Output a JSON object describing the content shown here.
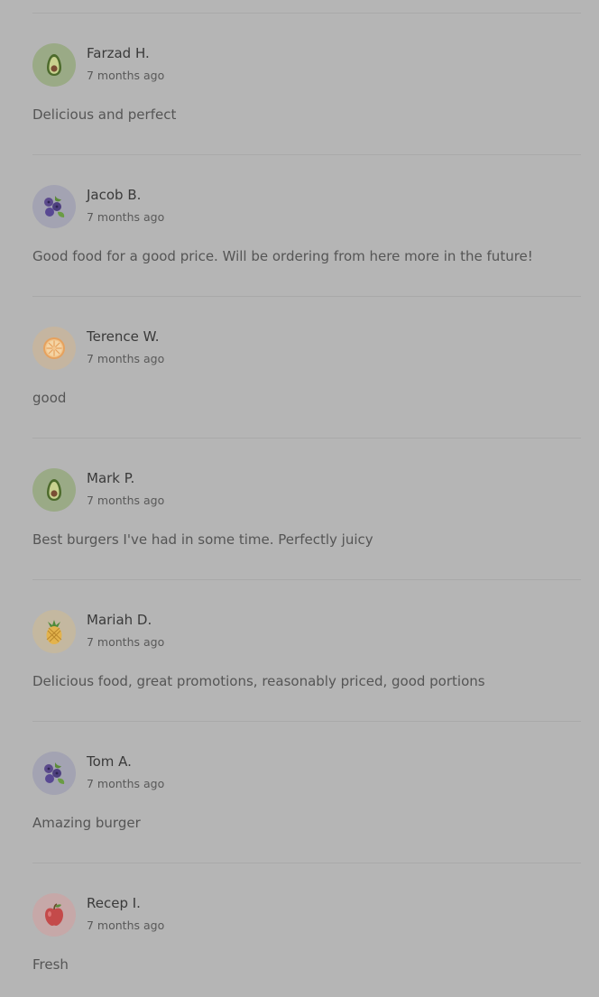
{
  "reviews": [
    {
      "name": "Farzad H.",
      "time": "7 months ago",
      "comment": "Delicious and perfect",
      "avatar_icon": "avocado-icon",
      "avatar_bg": "#9aaa86"
    },
    {
      "name": "Jacob B.",
      "time": "7 months ago",
      "comment": "Good food for a good price. Will be ordering from here more in the future!",
      "avatar_icon": "blueberry-icon",
      "avatar_bg": "#a3a3b2"
    },
    {
      "name": "Terence W.",
      "time": "7 months ago",
      "comment": "good",
      "avatar_icon": "orange-slice-icon",
      "avatar_bg": "#c5b5a0"
    },
    {
      "name": "Mark P.",
      "time": "7 months ago",
      "comment": "Best burgers I've had in some time. Perfectly juicy",
      "avatar_icon": "avocado-icon",
      "avatar_bg": "#9aaa86"
    },
    {
      "name": "Mariah D.",
      "time": "7 months ago",
      "comment": "Delicious food, great promotions, reasonably priced, good portions",
      "avatar_icon": "pineapple-icon",
      "avatar_bg": "#c4b8a0"
    },
    {
      "name": "Tom A.",
      "time": "7 months ago",
      "comment": "Amazing burger",
      "avatar_icon": "blueberry-icon",
      "avatar_bg": "#a3a3b2"
    },
    {
      "name": "Recep I.",
      "time": "7 months ago",
      "comment": "Fresh",
      "avatar_icon": "apple-icon",
      "avatar_bg": "#c6a8a8"
    }
  ]
}
